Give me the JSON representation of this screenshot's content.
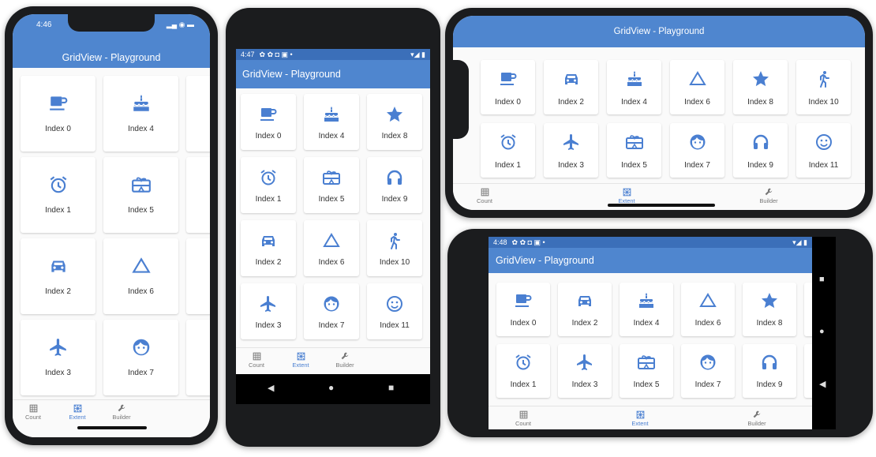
{
  "app_title": "GridView - Playground",
  "accent": "#4f86cf",
  "phones": {
    "iphone_portrait": {
      "time": "4:46"
    },
    "android_portrait": {
      "time": "4:47"
    },
    "android_landscape": {
      "time": "4:48"
    }
  },
  "grids": {
    "iphone_portrait": [
      {
        "label": "Index 0",
        "icon": "coffee-icon"
      },
      {
        "label": "Index 4",
        "icon": "cake-icon"
      },
      {
        "label": "Index 1",
        "icon": "alarm-icon"
      },
      {
        "label": "Index 5",
        "icon": "gift-card-icon"
      },
      {
        "label": "Index 2",
        "icon": "car-icon"
      },
      {
        "label": "Index 6",
        "icon": "triangle-icon"
      },
      {
        "label": "Index 3",
        "icon": "airplane-icon"
      },
      {
        "label": "Index 7",
        "icon": "face-icon"
      }
    ],
    "android_portrait": [
      {
        "label": "Index 0",
        "icon": "coffee-icon"
      },
      {
        "label": "Index 4",
        "icon": "cake-icon"
      },
      {
        "label": "Index 8",
        "icon": "star-icon"
      },
      {
        "label": "Index 1",
        "icon": "alarm-icon"
      },
      {
        "label": "Index 5",
        "icon": "gift-card-icon"
      },
      {
        "label": "Index 9",
        "icon": "headset-icon"
      },
      {
        "label": "Index 2",
        "icon": "car-icon"
      },
      {
        "label": "Index 6",
        "icon": "triangle-icon"
      },
      {
        "label": "Index 10",
        "icon": "walk-icon"
      },
      {
        "label": "Index 3",
        "icon": "airplane-icon"
      },
      {
        "label": "Index 7",
        "icon": "face-icon"
      },
      {
        "label": "Index 11",
        "icon": "smiley-icon"
      }
    ],
    "iphone_landscape": [
      {
        "label": "Index 0",
        "icon": "coffee-icon"
      },
      {
        "label": "Index 2",
        "icon": "car-icon"
      },
      {
        "label": "Index 4",
        "icon": "cake-icon"
      },
      {
        "label": "Index 6",
        "icon": "triangle-icon"
      },
      {
        "label": "Index 8",
        "icon": "star-icon"
      },
      {
        "label": "Index 10",
        "icon": "walk-icon"
      },
      {
        "label": "Index 1",
        "icon": "alarm-icon"
      },
      {
        "label": "Index 3",
        "icon": "airplane-icon"
      },
      {
        "label": "Index 5",
        "icon": "gift-card-icon"
      },
      {
        "label": "Index 7",
        "icon": "face-icon"
      },
      {
        "label": "Index 9",
        "icon": "headset-icon"
      },
      {
        "label": "Index 11",
        "icon": "smiley-icon"
      }
    ],
    "android_landscape": [
      {
        "label": "Index 0",
        "icon": "coffee-icon"
      },
      {
        "label": "Index 2",
        "icon": "car-icon"
      },
      {
        "label": "Index 4",
        "icon": "cake-icon"
      },
      {
        "label": "Index 6",
        "icon": "triangle-icon"
      },
      {
        "label": "Index 8",
        "icon": "star-icon"
      },
      {
        "label": "Index 1",
        "icon": "alarm-icon"
      },
      {
        "label": "Index 3",
        "icon": "airplane-icon"
      },
      {
        "label": "Index 5",
        "icon": "gift-card-icon"
      },
      {
        "label": "Index 7",
        "icon": "face-icon"
      },
      {
        "label": "Index 9",
        "icon": "headset-icon"
      }
    ]
  },
  "nav": [
    {
      "label": "Count",
      "icon": "grid-icon"
    },
    {
      "label": "Extent",
      "icon": "grid-extent-icon",
      "active": true
    },
    {
      "label": "Builder",
      "icon": "wrench-icon"
    }
  ]
}
